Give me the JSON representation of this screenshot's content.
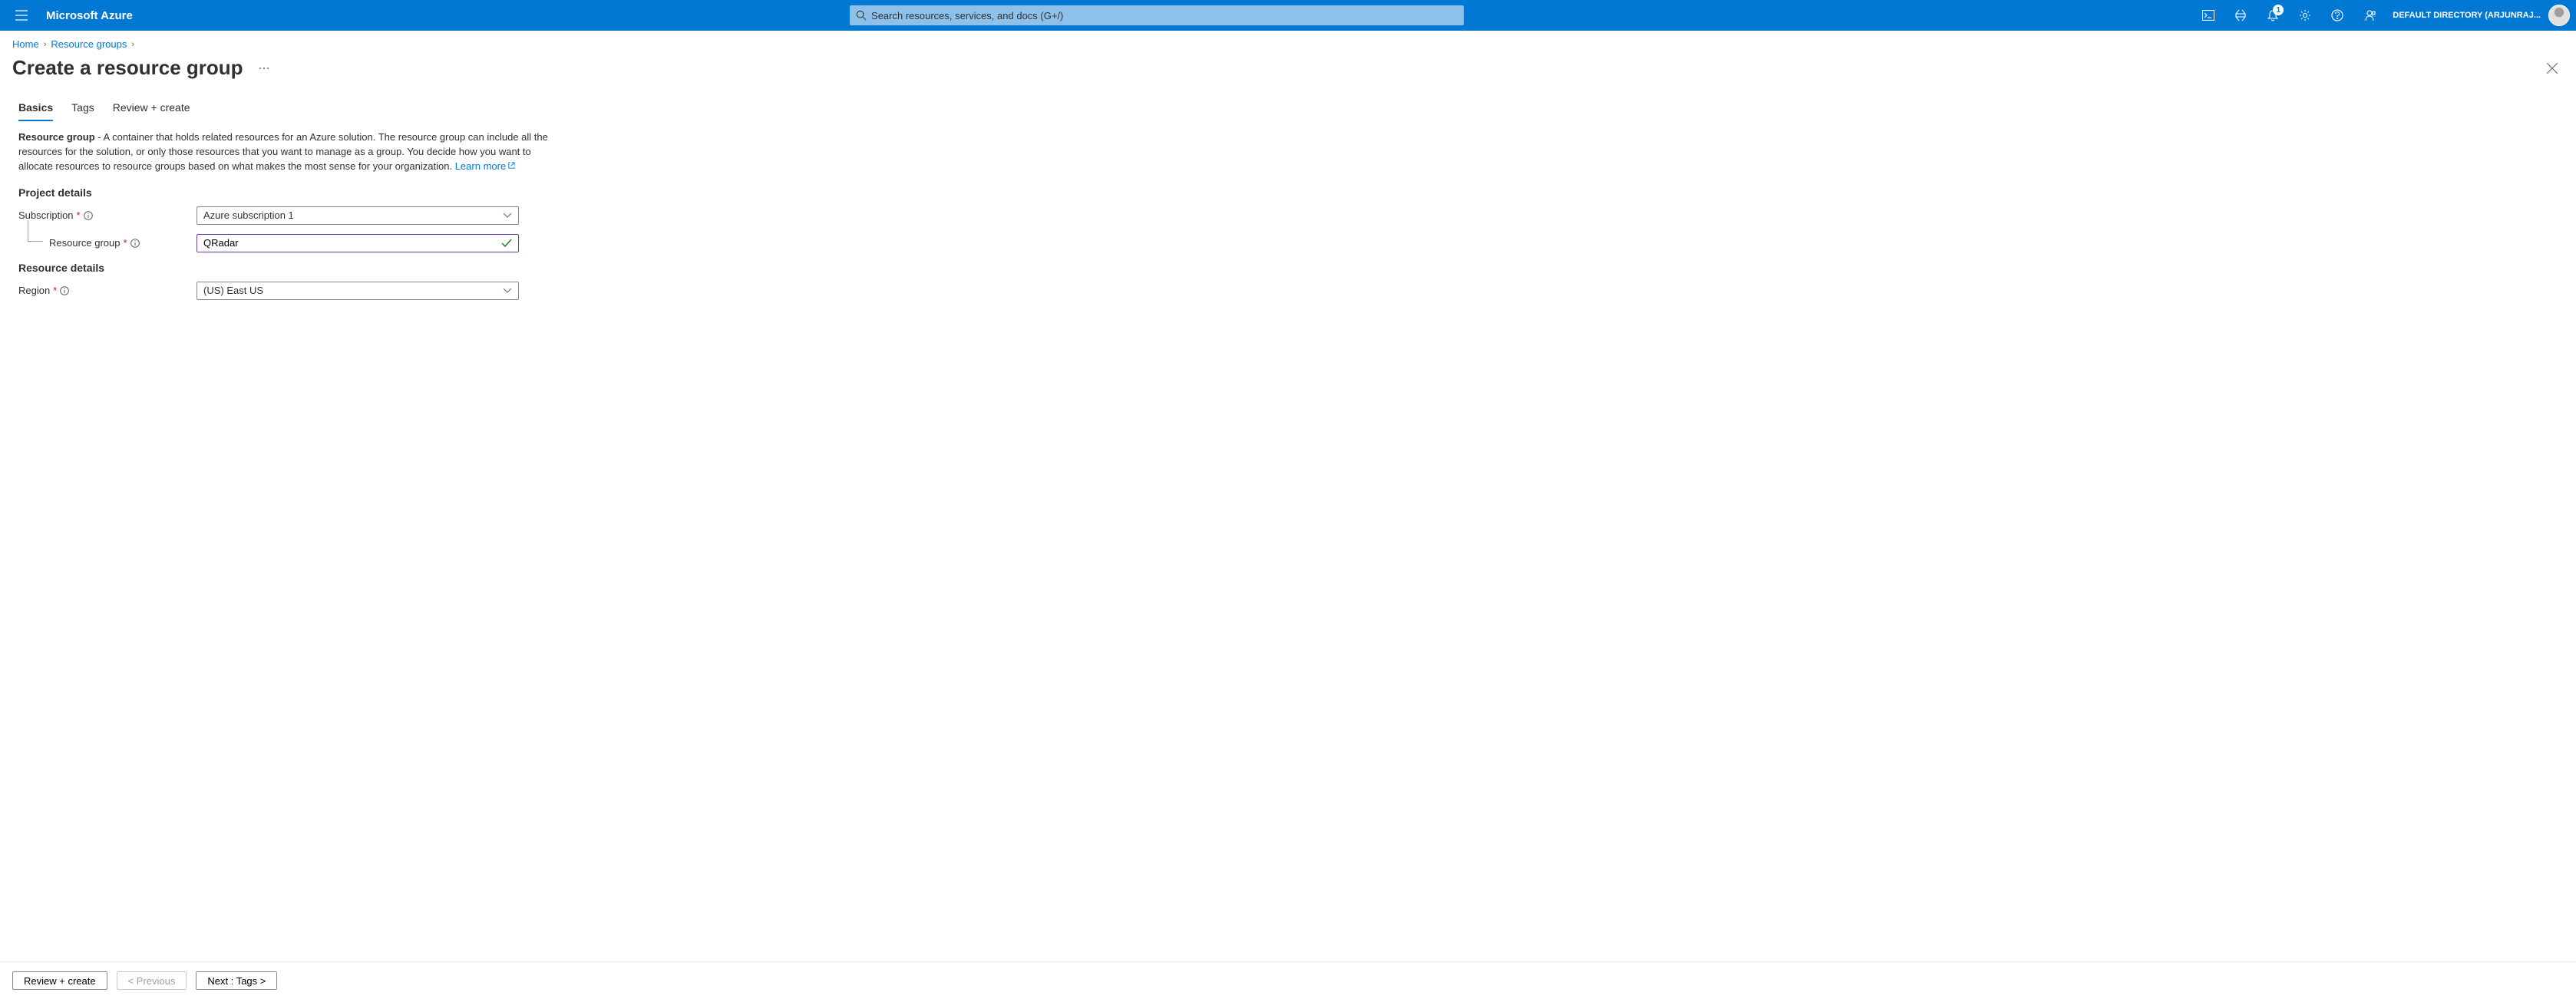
{
  "header": {
    "brand": "Microsoft Azure",
    "search_placeholder": "Search resources, services, and docs (G+/)",
    "notification_count": "1",
    "directory_label": "DEFAULT DIRECTORY (ARJUNRAJ..."
  },
  "breadcrumb": {
    "items": [
      {
        "label": "Home"
      },
      {
        "label": "Resource groups"
      }
    ]
  },
  "page": {
    "title": "Create a resource group"
  },
  "tabs": [
    {
      "label": "Basics",
      "active": true
    },
    {
      "label": "Tags",
      "active": false
    },
    {
      "label": "Review + create",
      "active": false
    }
  ],
  "description": {
    "lead_bold": "Resource group",
    "text": " - A container that holds related resources for an Azure solution. The resource group can include all the resources for the solution, or only those resources that you want to manage as a group. You decide how you want to allocate resources to resource groups based on what makes the most sense for your organization. ",
    "learn_more": "Learn more"
  },
  "sections": {
    "project_details_heading": "Project details",
    "resource_details_heading": "Resource details"
  },
  "fields": {
    "subscription": {
      "label": "Subscription",
      "value": "Azure subscription 1"
    },
    "resource_group": {
      "label": "Resource group",
      "value": "QRadar"
    },
    "region": {
      "label": "Region",
      "value": "(US) East US"
    }
  },
  "footer": {
    "review_create": "Review + create",
    "previous": "< Previous",
    "next": "Next : Tags >"
  }
}
